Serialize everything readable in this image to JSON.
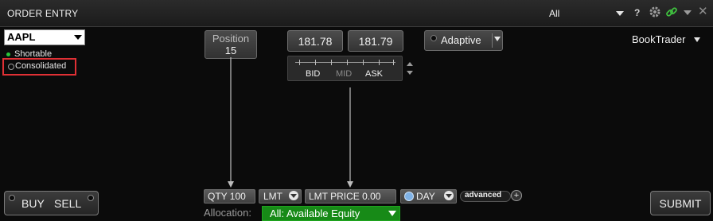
{
  "window": {
    "title": "ORDER ENTRY",
    "scope": "All",
    "help": "?"
  },
  "symbol": {
    "ticker": "AAPL",
    "shortable": "Shortable",
    "consolidated": "Consolidated"
  },
  "position": {
    "label": "Position",
    "value": "15"
  },
  "quote": {
    "bid": "181.78",
    "ask": "181.79",
    "bid_label": "BID",
    "mid_label": "MID",
    "ask_label": "ASK"
  },
  "algo": {
    "label": "Adaptive"
  },
  "booktrader": {
    "label": "BookTrader"
  },
  "actions": {
    "buy": "BUY",
    "sell": "SELL",
    "submit": "SUBMIT"
  },
  "order": {
    "qty": "QTY 100",
    "order_type": "LMT",
    "limit_price": "LMT PRICE  0.00",
    "tif": "DAY",
    "advanced": "advanced",
    "plus": "+"
  },
  "allocation": {
    "label": "Allocation:",
    "value": "All: Available Equity"
  },
  "icons": {
    "gear": "gear-icon",
    "link": "link-icon",
    "close": "close-icon",
    "clock": "clock-icon"
  },
  "colors": {
    "background": "#0b0b0b",
    "allocation_green": "#178a17",
    "shortable_green": "#27c73a",
    "highlight_red": "#e03035",
    "link_green": "#3fbf3f"
  }
}
